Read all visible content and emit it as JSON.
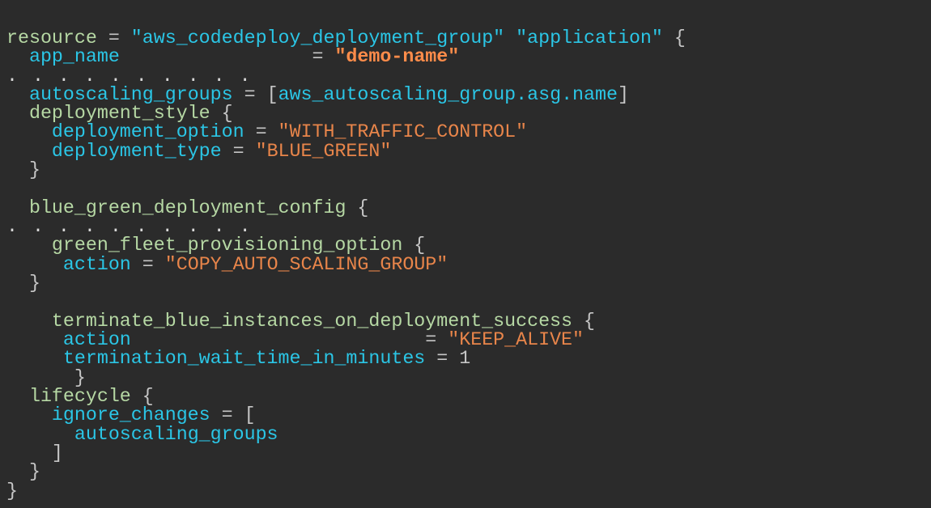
{
  "colors": {
    "background": "#2b2b2b",
    "keyword": "#b6d8a4",
    "attribute": "#2bc6e6",
    "string": "#e8854a",
    "punctuation": "#c6c6c6"
  },
  "code": {
    "l1": {
      "kw": "resource",
      "eq": " = ",
      "s1": "\"aws_codedeploy_deployment_group\"",
      "s2": " \"application\"",
      "brace": " {"
    },
    "l2": {
      "attr": "app_name",
      "pad": "                 = ",
      "str": "\"demo-name\""
    },
    "l3": {
      "dots": ". . . . . . . . . ."
    },
    "l4": {
      "attr": "autoscaling_groups",
      "eq": " = ",
      "open": "[",
      "ref": "aws_autoscaling_group.asg.name",
      "close": "]"
    },
    "l5": {
      "kw": "deployment_style",
      "brace": " {"
    },
    "l6": {
      "attr": "deployment_option",
      "eq": " = ",
      "str": "\"WITH_TRAFFIC_CONTROL\""
    },
    "l7": {
      "attr": "deployment_type",
      "eq": " = ",
      "str": "\"BLUE_GREEN\""
    },
    "l8": {
      "brace": "}"
    },
    "l9": {
      "kw": "blue_green_deployment_config",
      "brace": " {"
    },
    "l10": {
      "dots": ". . . . . . . . . ."
    },
    "l11": {
      "kw": "green_fleet_provisioning_option",
      "brace": " {"
    },
    "l12": {
      "attr": "action",
      "eq": " = ",
      "str": "\"COPY_AUTO_SCALING_GROUP\""
    },
    "l13": {
      "brace": "}"
    },
    "l14": {
      "kw": "terminate_blue_instances_on_deployment_success",
      "brace": " {"
    },
    "l15": {
      "attr": "action",
      "pad": "                          = ",
      "str": "\"KEEP_ALIVE\""
    },
    "l16": {
      "attr": "termination_wait_time_in_minutes",
      "eq": " = ",
      "num": "1"
    },
    "l17": {
      "brace": "}"
    },
    "l18": {
      "kw": "lifecycle",
      "brace": " {"
    },
    "l19": {
      "attr": "ignore_changes",
      "eq": " = ",
      "open": "["
    },
    "l20": {
      "attr": "autoscaling_groups"
    },
    "l21": {
      "close": "]"
    },
    "l22": {
      "brace": "}"
    },
    "l23": {
      "brace": "}"
    }
  }
}
